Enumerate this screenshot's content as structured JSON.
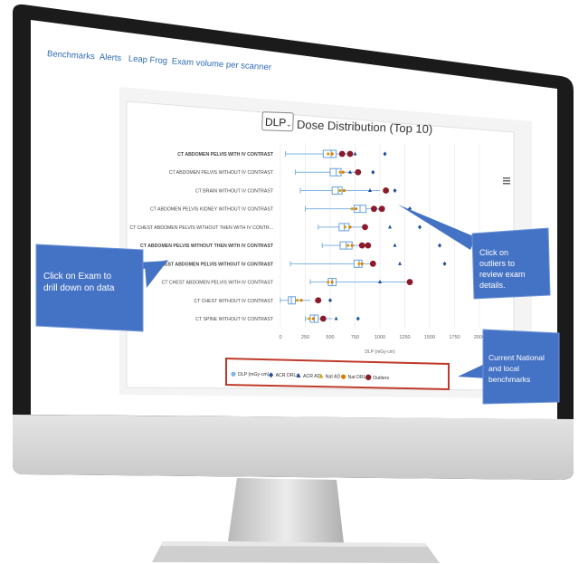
{
  "nav": {
    "tabs": [
      "Benchmarks",
      "Alerts",
      "Leap Frog",
      "Exam volume per scanner"
    ]
  },
  "chart": {
    "metric_select": "DLP",
    "title": "Dose Distribution (Top 10)",
    "menu_icon": "hamburger-menu-icon",
    "xlabel": "DLP (mGy·cm)",
    "x_ticks": [
      "0",
      "250",
      "500",
      "750",
      "1000",
      "1250",
      "1500",
      "1750",
      "2000"
    ]
  },
  "legend": [
    "DLP (mGy·cm)",
    "ACR DRLs",
    "ACR AD",
    "Nat AD",
    "Nat DRL",
    "Outliers"
  ],
  "callouts": {
    "drill": "Click on Exam to drill down on data",
    "outliers": "Click on outliers to review exam details.",
    "benchmarks": "Current National and local benchmarks"
  },
  "colors": {
    "accent": "#4472c4",
    "outlier": "#8b1a2a",
    "box": "#7fb3e6",
    "legend_border": "#c0392b"
  },
  "chart_data": {
    "type": "box",
    "title": "Dose Distribution (Top 10)",
    "xlabel": "DLP (mGy·cm)",
    "xlim": [
      0,
      2000
    ],
    "categories": [
      "CT ABDOMEN PELVIS WITH IV CONTRAST",
      "CT ABDOMEN PELVIS WITHOUT IV CONTRAST",
      "CT BRAIN WITHOUT IV CONTRAST",
      "CT ABDOMEN PELVIS KIDNEY WITHOUT IV CONTRAST",
      "CT CHEST ABDOMEN PELVIS WITHOUT THEN WITH IV CONTR...",
      "CT ABDOMEN PELVIS WITHOUT THEN WITH IV CONTRAST",
      "CT CHEST ABDOMEN PELVIS WITHOUT IV CONTRAST",
      "CT CHEST ABDOMEN PELVIS WITH IV CONTRAST",
      "CT CHEST WITHOUT IV CONTRAST",
      "CT SPINE WITHOUT IV CONTRAST"
    ],
    "series": [
      {
        "name": "DLP (mGy·cm)",
        "values": [
          {
            "min": 50,
            "q1": 430,
            "median": 510,
            "q3": 560,
            "max": 700
          },
          {
            "min": 150,
            "q1": 500,
            "median": 560,
            "q3": 610,
            "max": 760
          },
          {
            "min": 200,
            "q1": 520,
            "median": 580,
            "q3": 620,
            "max": 1000
          },
          {
            "min": 250,
            "q1": 740,
            "median": 800,
            "q3": 860,
            "max": 1000
          },
          {
            "min": 380,
            "q1": 590,
            "median": 640,
            "q3": 690,
            "max": 880
          },
          {
            "min": 420,
            "q1": 600,
            "median": 660,
            "q3": 720,
            "max": 820
          },
          {
            "min": 100,
            "q1": 740,
            "median": 790,
            "q3": 820,
            "max": 950
          },
          {
            "min": 300,
            "q1": 480,
            "median": 520,
            "q3": 560,
            "max": 1300
          },
          {
            "min": 0,
            "q1": 80,
            "median": 110,
            "q3": 150,
            "max": 300
          },
          {
            "min": 250,
            "q1": 300,
            "median": 340,
            "q3": 380,
            "max": 520
          }
        ]
      },
      {
        "name": "ACR DRLs",
        "values": [
          1050,
          930,
          1150,
          1300,
          1400,
          1600,
          1650,
          1300,
          500,
          780
        ]
      },
      {
        "name": "ACR AD",
        "values": [
          750,
          700,
          900,
          1000,
          1100,
          1150,
          1200,
          1000,
          360,
          560
        ]
      },
      {
        "name": "Nat AD",
        "values": [
          480,
          600,
          600,
          720,
          650,
          680,
          790,
          480,
          170,
          290
        ]
      },
      {
        "name": "Nat DRL",
        "values": [
          520,
          630,
          640,
          760,
          700,
          720,
          820,
          520,
          210,
          330
        ]
      },
      {
        "name": "Outliers",
        "values": [
          [
            620,
            700
          ],
          [
            780
          ],
          [
            1060
          ],
          [
            940,
            1020
          ],
          [
            850
          ],
          [
            820,
            880
          ],
          [
            930
          ],
          [
            1300
          ],
          [
            380
          ],
          [
            430
          ]
        ]
      }
    ],
    "legend_position": "bottom"
  }
}
